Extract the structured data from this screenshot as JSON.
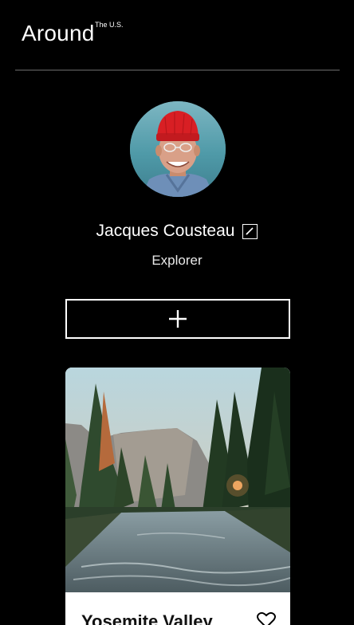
{
  "header": {
    "logo_text": "Around",
    "logo_superscript": "The U.S."
  },
  "profile": {
    "avatar_alt": "Jacques Cousteau",
    "name": "Jacques Cousteau",
    "role": "Explorer"
  },
  "actions": {
    "add_icon": "plus-icon"
  },
  "cards": [
    {
      "title": "Yosemite Valley",
      "like_icon": "heart-icon"
    }
  ],
  "colors": {
    "background": "#000000",
    "text": "#ffffff",
    "card_background": "#ffffff",
    "card_title": "#111111",
    "divider": "#3a3a3a"
  }
}
